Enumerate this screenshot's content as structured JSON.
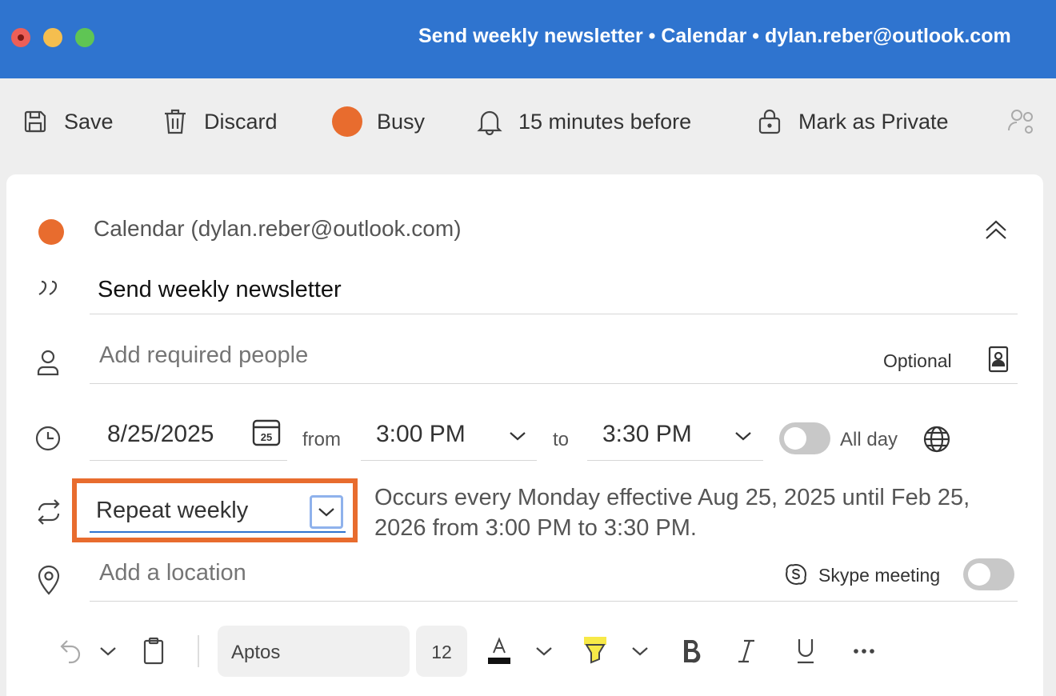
{
  "window": {
    "title": "Send weekly newsletter • Calendar • dylan.reber@outlook.com"
  },
  "toolbar": {
    "save_label": "Save",
    "discard_label": "Discard",
    "busy_label": "Busy",
    "reminder_label": "15 minutes before",
    "private_label": "Mark as Private"
  },
  "event": {
    "calendar_name": "Calendar (dylan.reber@outlook.com)",
    "title": "Send weekly newsletter",
    "people_placeholder": "Add required people",
    "optional_label": "Optional",
    "date": "8/25/2025",
    "calendar_icon_day": "25",
    "from_label": "from",
    "start_time": "3:00 PM",
    "to_label": "to",
    "end_time": "3:30 PM",
    "all_day_label": "All day",
    "all_day_on": false,
    "repeat_value": "Repeat weekly",
    "occurs_text": "Occurs every Monday effective Aug 25, 2025 until Feb 25, 2026 from 3:00 PM to 3:30 PM.",
    "location_placeholder": "Add a location",
    "skype_label": "Skype meeting",
    "skype_on": false
  },
  "format": {
    "font_name": "Aptos",
    "font_size": "12"
  },
  "colors": {
    "titlebar": "#2f74cf",
    "busy": "#e86c2e",
    "highlight_box": "#e86c2e"
  }
}
